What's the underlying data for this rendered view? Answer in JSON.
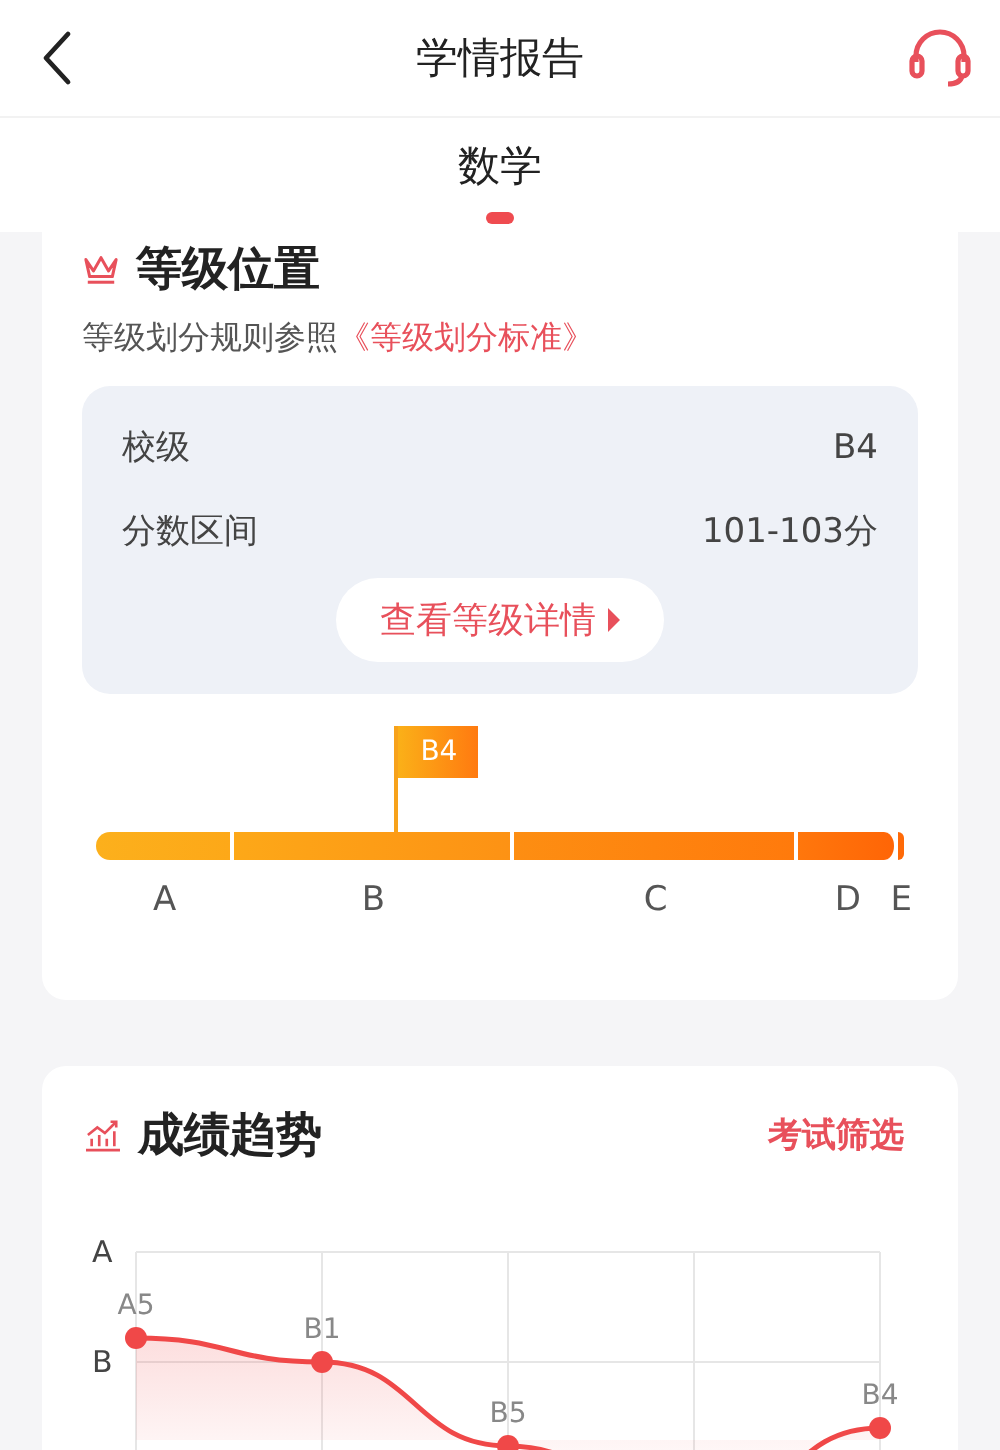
{
  "header": {
    "title": "学情报告"
  },
  "tabs": [
    {
      "label": "数学",
      "selected": true
    }
  ],
  "grade_position": {
    "title": "等级位置",
    "rule_text": "等级划分规则参照",
    "rule_link": "《等级划分标准》",
    "rows": [
      {
        "label": "校级",
        "value": "B4"
      },
      {
        "label": "分数区间",
        "value": "101-103分"
      }
    ],
    "detail_button": "查看等级详情",
    "marker": {
      "label": "B4"
    },
    "segments": [
      "A",
      "B",
      "C",
      "D",
      "E"
    ]
  },
  "trend": {
    "title": "成绩趋势",
    "filter_link": "考试筛选",
    "axis_labels": [
      "A",
      "B"
    ],
    "point_labels": [
      "A5",
      "B1",
      "B5",
      "B4"
    ]
  }
}
